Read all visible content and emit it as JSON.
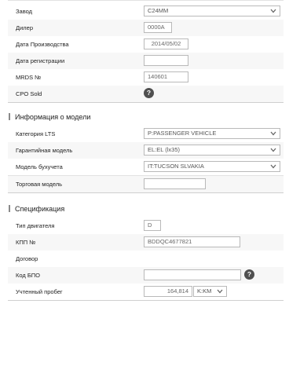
{
  "section1": {
    "rows": {
      "plant": {
        "label": "Завод",
        "value": "C24MM"
      },
      "dealer": {
        "label": "Дилер",
        "value": "0000A"
      },
      "prod_date": {
        "label": "Дата Производства",
        "value": "2014/05/02"
      },
      "reg_date": {
        "label": "Дата регистрации",
        "value": ""
      },
      "mrds": {
        "label": "MRDS №",
        "value": "140601"
      },
      "cpo": {
        "label": "CPO Sold",
        "help": "?"
      }
    }
  },
  "section2": {
    "title": "Информация о модели",
    "rows": {
      "lts": {
        "label": "Категория LTS",
        "value": "P:PASSENGER VEHICLE"
      },
      "warranty_model": {
        "label": "Гарантийная модель",
        "value": "EL:EL (lx35)"
      },
      "acc_model": {
        "label": "Модель бухучета",
        "value": "IT:TUCSON SLVAKIA"
      },
      "trade_model": {
        "label": "Торговая модель",
        "value": ""
      }
    }
  },
  "section3": {
    "title": "Спецификация",
    "rows": {
      "engine": {
        "label": "Тип двигателя",
        "value": "D"
      },
      "gearbox": {
        "label": "КПП №",
        "value": "BDDQC4677821"
      },
      "contract": {
        "label": "Договор"
      },
      "bpo": {
        "label": "Код БПО",
        "value": "",
        "help": "?"
      },
      "mileage": {
        "label": "Учтенный пробег",
        "value": "164,814",
        "unit": "K:KM"
      }
    }
  },
  "icons": {
    "dropdown": "chevron-down-icon",
    "help": "help-circle-icon"
  }
}
